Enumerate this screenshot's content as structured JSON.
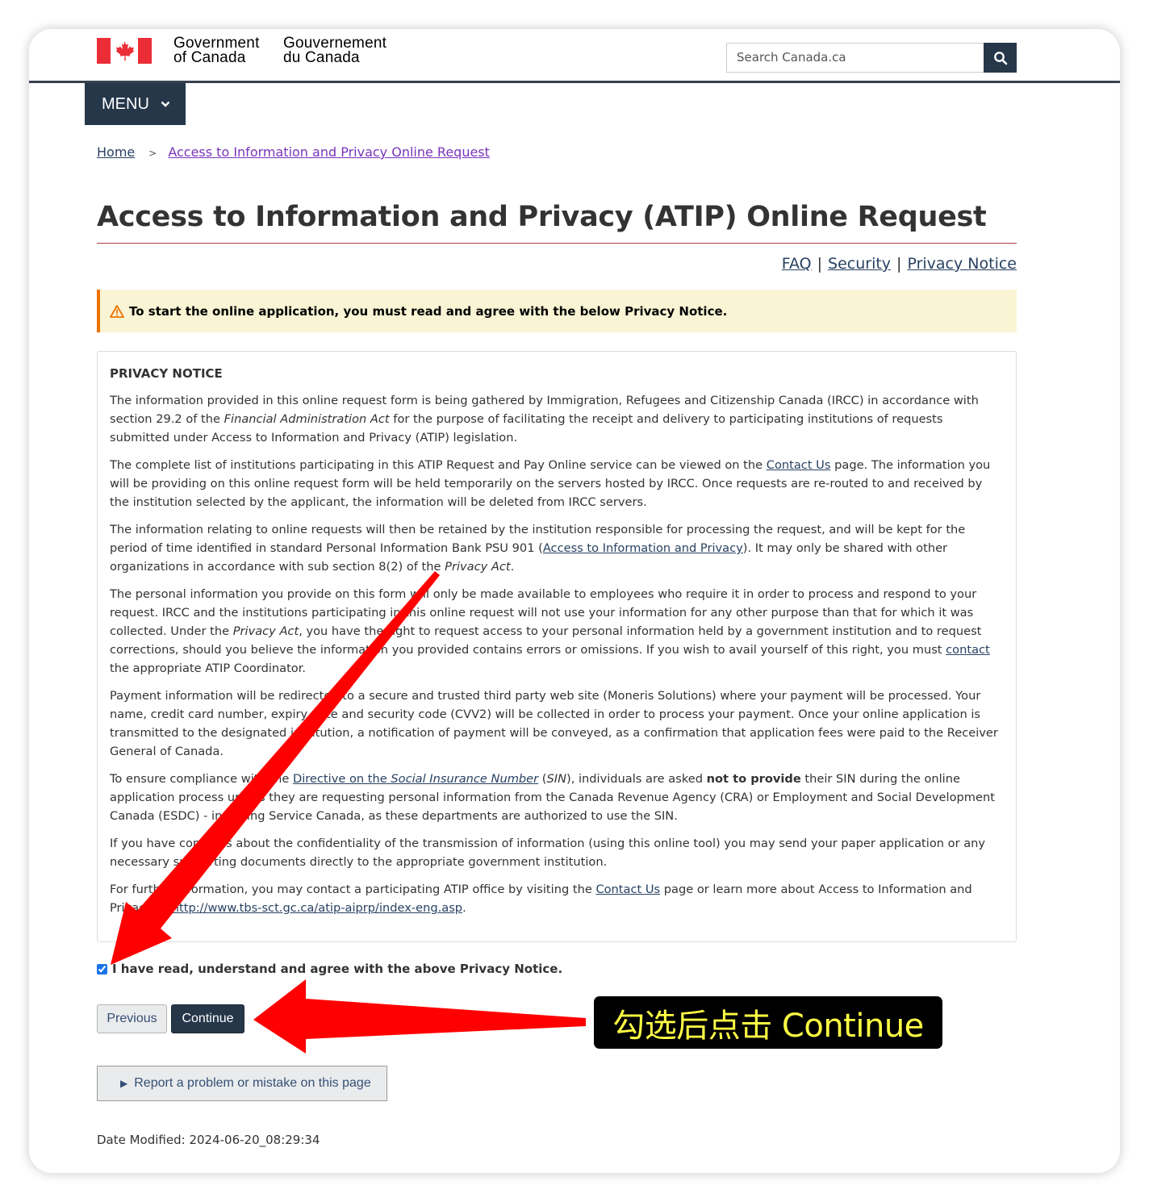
{
  "header": {
    "gov_en_line1": "Government",
    "gov_en_line2": "of Canada",
    "gov_fr_line1": "Gouvernement",
    "gov_fr_line2": "du Canada",
    "search_placeholder": "Search Canada.ca",
    "menu_label": "MENU",
    "brand_red": "#eb2d37",
    "navy": "#26374a"
  },
  "breadcrumb": {
    "home": "Home",
    "separator": ">",
    "current": "Access to Information and Privacy Online Request"
  },
  "page": {
    "title": "Access to Information and Privacy (ATIP) Online Request",
    "links": [
      "FAQ",
      "Security",
      "Privacy Notice"
    ],
    "link_separator": "|"
  },
  "warning": {
    "text": "To start the online application, you must read and agree with the below Privacy Notice."
  },
  "notice": {
    "heading": "PRIVACY NOTICE",
    "p1_a": "The information provided in this online request form is being gathered by Immigration, Refugees and Citizenship Canada (IRCC) in accordance with section 29.2 of the ",
    "p1_em": "Financial Administration Act",
    "p1_b": " for the purpose of facilitating the receipt and delivery to participating institutions of requests submitted under Access to Information and Privacy (ATIP) legislation.",
    "p2_a": "The complete list of institutions participating in this ATIP Request and Pay Online service can be viewed on the ",
    "p2_link": "Contact Us",
    "p2_b": " page. The information you will be providing on this online request form will be held temporarily on the servers hosted by IRCC. Once requests are re-routed to and received by the institution selected by the applicant, the information will be deleted from IRCC servers.",
    "p3_a": "The information relating to online requests will then be retained by the institution responsible for processing the request, and will be kept for the period of time identified in standard Personal Information Bank PSU 901 (",
    "p3_link": "Access to Information and Privacy",
    "p3_b": "). It may only be shared with other organizations in accordance with sub section 8(2) of the ",
    "p3_em": "Privacy Act",
    "p3_c": ".",
    "p4_a": "The personal information you provide on this form will only be made available to employees who require it in order to process and respond to your request. IRCC and the institutions participating in this online request will not use your information for any other purpose than that for which it was collected. Under the ",
    "p4_em": "Privacy Act",
    "p4_b": ", you have the right to request access to your personal information held by a government institution and to request corrections, should you believe the information you provided contains errors or omissions. If you wish to avail yourself of this right, you must ",
    "p4_link": "contact",
    "p4_c": " the appropriate ATIP Coordinator.",
    "p5": "Payment information will be redirected to a secure and trusted third party web site (Moneris Solutions) where your payment will be processed. Your name, credit card number, expiry date and security code (CVV2) will be collected in order to process your payment. Once your online application is transmitted to the designated institution, a notification of payment will be conveyed, as a confirmation that application fees were paid to the Receiver General of Canada.",
    "p6_a": "To ensure compliance with the ",
    "p6_link_a": "Directive on the ",
    "p6_link_em": "Social Insurance Number",
    "p6_b": " (",
    "p6_em": "SIN",
    "p6_c": "), individuals are asked ",
    "p6_strong": "not to provide",
    "p6_d": " their SIN during the online application process unless they are requesting personal information from the Canada Revenue Agency (CRA) or Employment and Social Development Canada (ESDC) - including Service Canada, as these departments are authorized to use the SIN.",
    "p7": "If you have concerns about the confidentiality of the transmission of information (using this online tool) you may send your paper application or any necessary supporting documents directly to the appropriate government institution.",
    "p8_a": "For further information, you may contact a participating ATIP office by visiting the ",
    "p8_link": "Contact Us",
    "p8_b": " page or learn more about Access to Information and Privacy at ",
    "p8_url": "http://www.tbs-sct.gc.ca/atip-aiprp/index-eng.asp",
    "p8_c": "."
  },
  "form": {
    "agree_label": "I have read, understand and agree with the above Privacy Notice.",
    "agree_checked": true,
    "previous_label": "Previous",
    "continue_label": "Continue"
  },
  "footer": {
    "report_label": "Report a problem or mistake on this page",
    "date_modified": "Date Modified: 2024-06-20_08:29:34"
  },
  "annotation": {
    "label": "勾选后点击 Continue",
    "arrow_color": "#ff0000"
  }
}
